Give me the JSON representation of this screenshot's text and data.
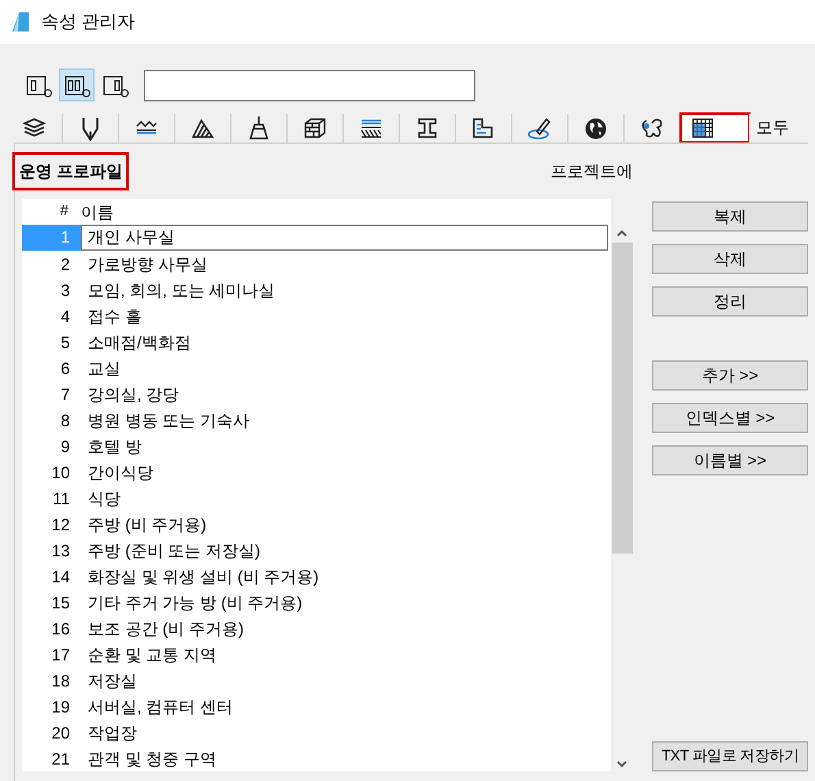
{
  "window": {
    "title": "속성 관리자"
  },
  "view_buttons": [
    {
      "selected": false
    },
    {
      "selected": true
    },
    {
      "selected": false
    }
  ],
  "tabs": [
    {
      "kind": "icon",
      "selected": false,
      "highlighted": false
    },
    {
      "kind": "icon",
      "selected": false,
      "highlighted": false
    },
    {
      "kind": "icon",
      "selected": false,
      "highlighted": false
    },
    {
      "kind": "icon",
      "selected": false,
      "highlighted": false
    },
    {
      "kind": "icon",
      "selected": false,
      "highlighted": false
    },
    {
      "kind": "icon",
      "selected": false,
      "highlighted": false
    },
    {
      "kind": "icon",
      "selected": false,
      "highlighted": false
    },
    {
      "kind": "icon",
      "selected": false,
      "highlighted": false
    },
    {
      "kind": "icon",
      "selected": false,
      "highlighted": false
    },
    {
      "kind": "icon",
      "selected": false,
      "highlighted": false
    },
    {
      "kind": "icon",
      "selected": false,
      "highlighted": false
    },
    {
      "kind": "icon",
      "selected": false,
      "highlighted": false
    },
    {
      "kind": "icon",
      "selected": true,
      "highlighted": true
    },
    {
      "kind": "text",
      "label": "모두",
      "selected": false,
      "highlighted": false
    }
  ],
  "section": {
    "title": "운영 프로파일",
    "highlighted": true,
    "scope": "프로젝트에"
  },
  "table": {
    "columns": [
      "#",
      "이름"
    ],
    "rows": [
      {
        "number": "1",
        "name": "개인 사무실",
        "selected": true
      },
      {
        "number": "2",
        "name": "가로방향 사무실",
        "selected": false
      },
      {
        "number": "3",
        "name": "모임, 회의, 또는 세미나실",
        "selected": false
      },
      {
        "number": "4",
        "name": "접수 홀",
        "selected": false
      },
      {
        "number": "5",
        "name": "소매점/백화점",
        "selected": false
      },
      {
        "number": "6",
        "name": "교실",
        "selected": false
      },
      {
        "number": "7",
        "name": "강의실, 강당",
        "selected": false
      },
      {
        "number": "8",
        "name": "병원 병동 또는 기숙사",
        "selected": false
      },
      {
        "number": "9",
        "name": "호텔 방",
        "selected": false
      },
      {
        "number": "10",
        "name": "간이식당",
        "selected": false
      },
      {
        "number": "11",
        "name": "식당",
        "selected": false
      },
      {
        "number": "12",
        "name": "주방 (비 주거용)",
        "selected": false
      },
      {
        "number": "13",
        "name": "주방 (준비 또는 저장실)",
        "selected": false
      },
      {
        "number": "14",
        "name": "화장실 및 위생 설비 (비 주거용)",
        "selected": false
      },
      {
        "number": "15",
        "name": "기타 주거 가능 방 (비 주거용)",
        "selected": false
      },
      {
        "number": "16",
        "name": "보조 공간 (비 주거용)",
        "selected": false
      },
      {
        "number": "17",
        "name": "순환 및 교통 지역",
        "selected": false
      },
      {
        "number": "18",
        "name": "저장실",
        "selected": false
      },
      {
        "number": "19",
        "name": "서버실, 컴퓨터 센터",
        "selected": false
      },
      {
        "number": "20",
        "name": "작업장",
        "selected": false
      },
      {
        "number": "21",
        "name": "관객 및 청중 구역",
        "selected": false
      }
    ]
  },
  "buttons": [
    {
      "label": "복제"
    },
    {
      "label": "삭제"
    },
    {
      "label": "정리"
    },
    {
      "label": "추가 >>"
    },
    {
      "label": "인덱스별 >>"
    },
    {
      "label": "이름별 >>"
    },
    {
      "label": "TXT 파일로 저장하기"
    }
  ]
}
